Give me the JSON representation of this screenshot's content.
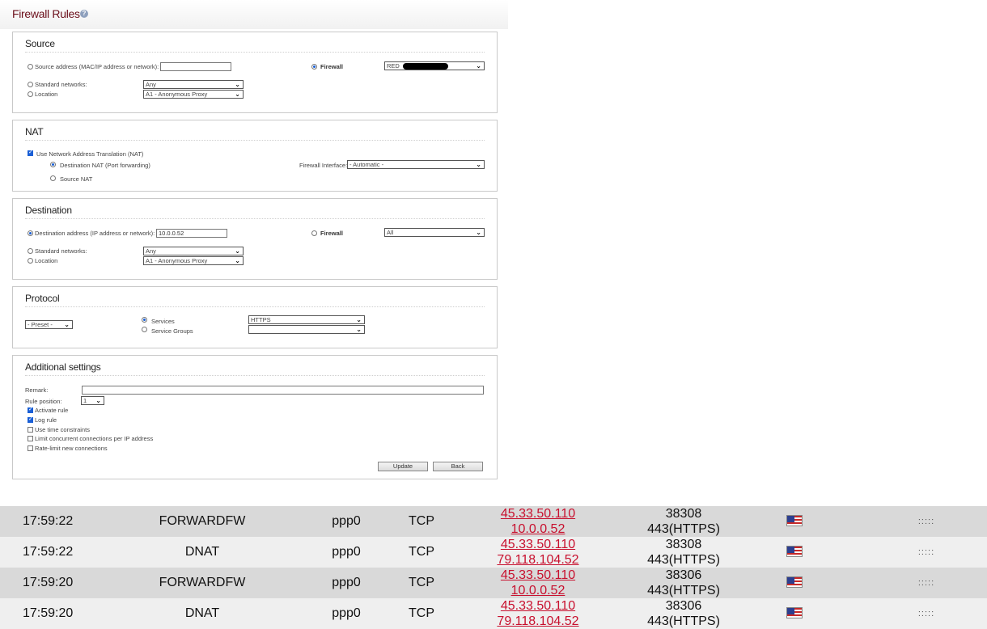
{
  "header": {
    "title": "Firewall Rules",
    "help_glyph": "?"
  },
  "source": {
    "title": "Source",
    "address_label": "Source address (MAC/IP address or network):",
    "address_value": "",
    "firewall_label": "Firewall",
    "firewall_select": "RED",
    "standard_networks_label": "Standard networks:",
    "standard_networks_value": "Any",
    "location_label": "Location",
    "location_value": "A1 - Anonymous Proxy"
  },
  "nat": {
    "title": "NAT",
    "use_nat_label": "Use Network Address Translation (NAT)",
    "dnat_label": "Destination NAT (Port forwarding)",
    "snat_label": "Source NAT",
    "fw_interface_label": "Firewall Interface:",
    "fw_interface_value": "- Automatic -"
  },
  "destination": {
    "title": "Destination",
    "address_label": "Destination address (IP address or network):",
    "address_value": "10.0.0.52",
    "firewall_label": "Firewall",
    "firewall_select": "All",
    "standard_networks_label": "Standard networks:",
    "standard_networks_value": "Any",
    "location_label": "Location",
    "location_value": "A1 - Anonymous Proxy"
  },
  "protocol": {
    "title": "Protocol",
    "preset_value": "- Preset -",
    "services_label": "Services",
    "service_groups_label": "Service Groups",
    "services_value": "HTTPS",
    "service_groups_value": ""
  },
  "additional": {
    "title": "Additional settings",
    "remark_label": "Remark:",
    "remark_value": "",
    "rule_position_label": "Rule position:",
    "rule_position_value": "1",
    "activate_label": "Activate rule",
    "log_label": "Log rule",
    "time_label": "Use time constraints",
    "concurrent_label": "Limit concurrent connections per IP address",
    "ratelimit_label": "Rate-limit new connections",
    "update_label": "Update",
    "back_label": "Back"
  },
  "log_rows": [
    {
      "time": "17:59:22",
      "chain": "FORWARDFW",
      "iface": "ppp0",
      "proto": "TCP",
      "src": "45.33.50.110",
      "dst": "10.0.0.52",
      "sport": "38308",
      "dport": "443(HTTPS)",
      "mac": "::::: "
    },
    {
      "time": "17:59:22",
      "chain": "DNAT",
      "iface": "ppp0",
      "proto": "TCP",
      "src": "45.33.50.110",
      "dst": "79.118.104.52",
      "sport": "38308",
      "dport": "443(HTTPS)",
      "mac": "::::: "
    },
    {
      "time": "17:59:20",
      "chain": "FORWARDFW",
      "iface": "ppp0",
      "proto": "TCP",
      "src": "45.33.50.110",
      "dst": "10.0.0.52",
      "sport": "38306",
      "dport": "443(HTTPS)",
      "mac": "::::: "
    },
    {
      "time": "17:59:20",
      "chain": "DNAT",
      "iface": "ppp0",
      "proto": "TCP",
      "src": "45.33.50.110",
      "dst": "79.118.104.52",
      "sport": "38306",
      "dport": "443(HTTPS)",
      "mac": "::::: "
    }
  ],
  "colors": {
    "title": "#6b0e1a",
    "link": "#c8102e",
    "radio_on": "#1a5fd6"
  },
  "icons": {
    "help": "help-icon",
    "flag": "us-flag-icon",
    "dropdown": "chevron-down-icon"
  }
}
